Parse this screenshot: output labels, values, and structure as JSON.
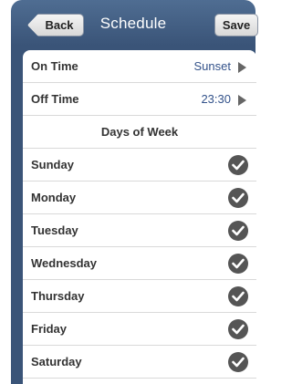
{
  "nav": {
    "title": "Schedule",
    "back_label": "Back",
    "save_label": "Save"
  },
  "settings": [
    {
      "label": "On Time",
      "value": "Sunset"
    },
    {
      "label": "Off Time",
      "value": "23:30"
    }
  ],
  "days_header": "Days of Week",
  "days": [
    {
      "label": "Sunday",
      "checked": true
    },
    {
      "label": "Monday",
      "checked": true
    },
    {
      "label": "Tuesday",
      "checked": true
    },
    {
      "label": "Wednesday",
      "checked": true
    },
    {
      "label": "Thursday",
      "checked": true
    },
    {
      "label": "Friday",
      "checked": true
    },
    {
      "label": "Saturday",
      "checked": true
    }
  ],
  "colors": {
    "navbar": "#3a5478",
    "value_text": "#33528a",
    "check_fill": "#555555"
  }
}
